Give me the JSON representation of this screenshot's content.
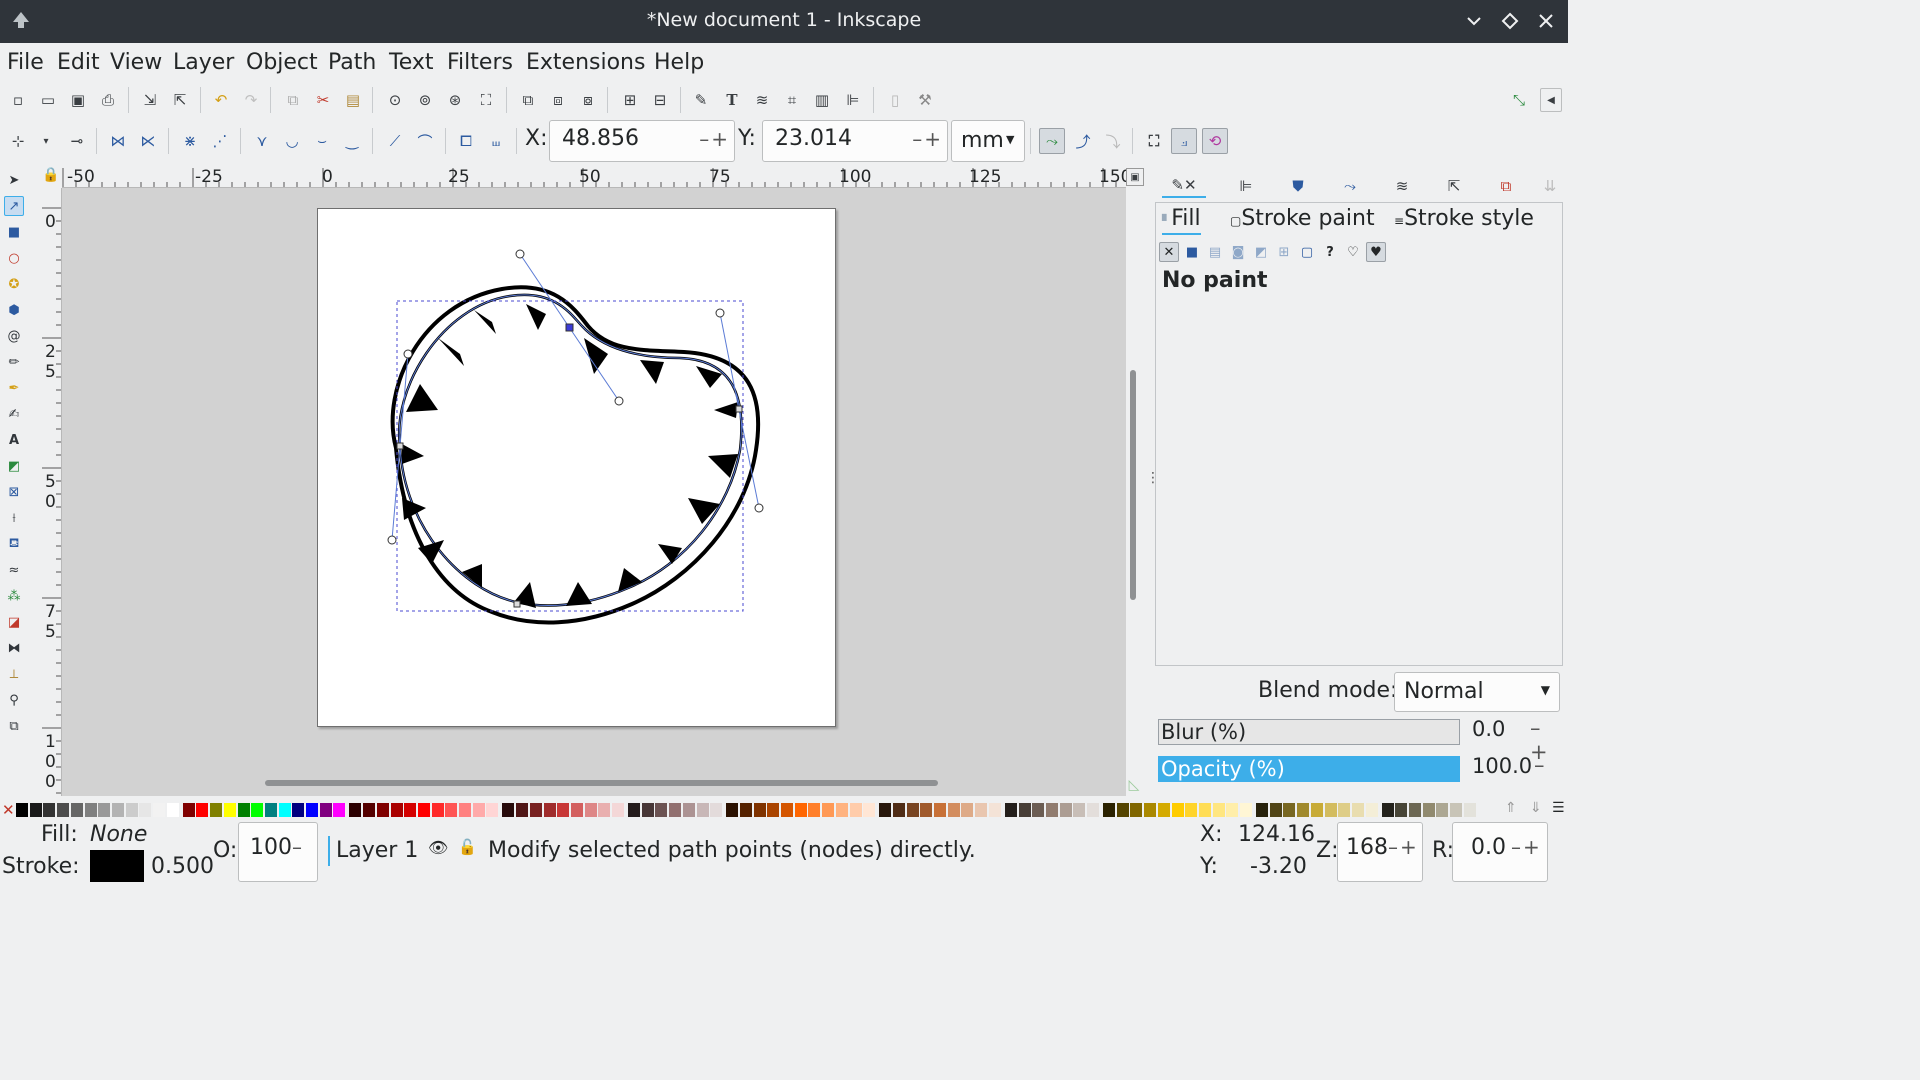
{
  "window": {
    "title": "*New document 1 - Inkscape"
  },
  "menu": [
    "File",
    "Edit",
    "View",
    "Layer",
    "Object",
    "Path",
    "Text",
    "Filters",
    "Extensions",
    "Help"
  ],
  "node_toolbar": {
    "x_label": "X:",
    "x_value": "48.856",
    "y_label": "Y:",
    "y_value": "23.014",
    "unit": "mm"
  },
  "ruler": {
    "h_ticks": [
      "-50",
      "-25",
      "0",
      "25",
      "50",
      "75",
      "100",
      "125",
      "150"
    ],
    "v_ticks": [
      "0",
      "25",
      "50",
      "75",
      "100"
    ]
  },
  "fill_stroke": {
    "tabs": [
      "Fill",
      "Stroke paint",
      "Stroke style"
    ],
    "paint_state": "No paint",
    "blend_label": "Blend mode:",
    "blend_value": "Normal",
    "blur_label": "Blur (%)",
    "blur_value": "0.0",
    "opacity_label": "Opacity (%)",
    "opacity_value": "100.0",
    "opacity_fraction": 1.0
  },
  "status": {
    "fill_label": "Fill:",
    "fill_value": "None",
    "stroke_label": "Stroke:",
    "stroke_width": "0.500",
    "opacity_label": "O:",
    "opacity_value": "100",
    "layer": "Layer 1",
    "message": "Modify selected path points (nodes) directly.",
    "cursor_x_label": "X:",
    "cursor_x": "124.16",
    "cursor_y_label": "Y:",
    "cursor_y": "-3.20",
    "zoom_label": "Z:",
    "zoom": "168",
    "rotation_label": "R:",
    "rotation": "0.0"
  },
  "colors": {
    "titlebar": "#2f343a",
    "accent": "#3daee9",
    "canvas": "#d2d2d2"
  },
  "palette": [
    "#000000",
    "#1a1a1a",
    "#333333",
    "#4d4d4d",
    "#666666",
    "#808080",
    "#999999",
    "#b3b3b3",
    "#cccccc",
    "#e6e6e6",
    "#f2f2f2",
    "#ffffff",
    "#800000",
    "#ff0000",
    "#808000",
    "#ffff00",
    "#008000",
    "#00ff00",
    "#008080",
    "#00ffff",
    "#000080",
    "#0000ff",
    "#800080",
    "#ff00ff",
    "#2b0000",
    "#550000",
    "#800000",
    "#aa0000",
    "#d40000",
    "#ff0000",
    "#ff2a2a",
    "#ff5555",
    "#ff8080",
    "#ffaaaa",
    "#ffd5d5",
    "#280b0b",
    "#501616",
    "#782121",
    "#a02c2c",
    "#c83737",
    "#d35f5f",
    "#de8787",
    "#e9afaf",
    "#f4d7d7",
    "#241c1c",
    "#483737",
    "#6c5353",
    "#916f6f",
    "#ac9393",
    "#c8b7b7",
    "#e3dbdb",
    "#2b1100",
    "#552200",
    "#803300",
    "#aa4400",
    "#d45500",
    "#ff6600",
    "#ff7f2a",
    "#ff9955",
    "#ffb380",
    "#ffccaa",
    "#ffe6d5",
    "#28170b",
    "#502d16",
    "#784421",
    "#a05a2c",
    "#c87137",
    "#d38d5f",
    "#deaa87",
    "#e9c6af",
    "#f4e3d7",
    "#241f1c",
    "#483e37",
    "#6c5d53",
    "#917c6f",
    "#ac9d93",
    "#c8beb7",
    "#e3dedb",
    "#2b2200",
    "#554400",
    "#806600",
    "#aa8800",
    "#d4aa00",
    "#ffcc00",
    "#ffd42a",
    "#ffdd55",
    "#ffe680",
    "#ffeeaa",
    "#fff6d5",
    "#28220b",
    "#504416",
    "#786721",
    "#a0892c",
    "#c8ab37",
    "#d3bc5f",
    "#decd87",
    "#e9ddaf",
    "#f4eed7",
    "#24221c",
    "#484537",
    "#6c6753",
    "#918a6f",
    "#aca793",
    "#c8c4b7",
    "#e3e2db"
  ]
}
